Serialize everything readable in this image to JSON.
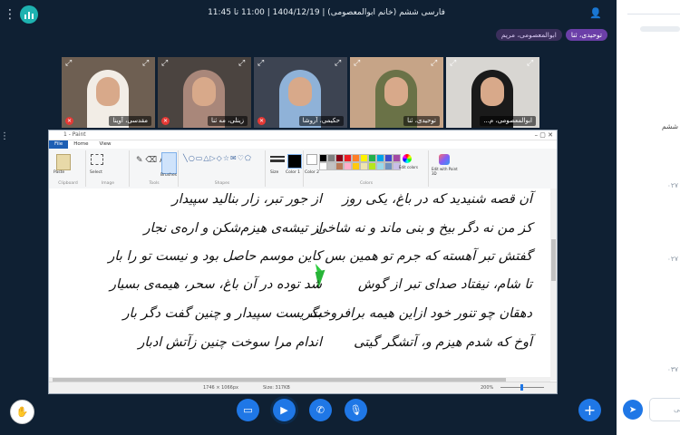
{
  "app": {
    "title": "فارسی ششم (خانم ابوالمعصومی) | 1404/12/19 | 11:00 تا 11:45",
    "speakers": [
      "توحیدی، ثنا",
      "ابوالمعصومی، مریم"
    ]
  },
  "participants": [
    {
      "name": "مقدسی، آوینا",
      "muted": true,
      "bg": "#6e5f52",
      "hijab": "#f2ede6",
      "selected": false
    },
    {
      "name": "زینلی، مه ثنا",
      "muted": true,
      "bg": "#4b4440",
      "hijab": "#a9877a",
      "selected": false
    },
    {
      "name": "حکیمی، آروشا",
      "muted": true,
      "bg": "#3d4452",
      "hijab": "#8fb2d8",
      "selected": false
    },
    {
      "name": "توحیدی، ثنا",
      "muted": false,
      "bg": "#c6a487",
      "hijab": "#6a7247",
      "selected": true
    },
    {
      "name": "ابوالمعصومی، م...",
      "muted": false,
      "bg": "#d8d6d2",
      "hijab": "#1a1a1a",
      "selected": false
    }
  ],
  "paint": {
    "window_title": "1 - Paint",
    "tabs": [
      "File",
      "Home",
      "View"
    ],
    "groups": [
      "Clipboard",
      "Image",
      "Tools",
      "Shapes",
      "Colors"
    ],
    "tools": {
      "paste": "Paste",
      "select": "Select",
      "brushes": "Brushes",
      "size": "Size",
      "color1": "Color 1",
      "color2": "Color 2",
      "edit_colors": "Edit colors",
      "paint3d": "Edit with Paint 3D"
    },
    "status_dims": "1746 × 1066px",
    "status_size": "Size: 317KB",
    "zoom": "200%",
    "palette": [
      "#000000",
      "#7f7f7f",
      "#880015",
      "#ed1c24",
      "#ff7f27",
      "#fff200",
      "#22b14c",
      "#00a2e8",
      "#3f48cc",
      "#a349a4",
      "#ffffff",
      "#c3c3c3",
      "#b97a57",
      "#ffaec9",
      "#ffc90e",
      "#efe4b0",
      "#b5e61d",
      "#99d9ea",
      "#7092be",
      "#c8bfe7"
    ],
    "poem_right": [
      "آن قصه شنیدید که در باغ، یکی روز",
      "کز من نه دگر بیخ و بنی ماند و نه شاخی",
      "گفتش تبر آهسته که جرم تو همین بس",
      "تا شام، نیفتاد صدای تبر از گوش",
      "دهقان چو تنور خود ازاین هیمه برافروخت",
      "آوخ که شدم هیزم و، آتشگر گیتی"
    ],
    "poem_left": [
      "از جور تبر، زار بنالید سپیدار",
      "از تیشه‌ی هیزم‌شکن و اره‌ی نجار",
      "کاین موسم حاصل بود و نیست تو را بار",
      "شد توده در آن باغ، سحر، هیمه‌ی بسیار",
      "بگریست سپیدار و چنین گفت دگر بار",
      "اندام مرا سوخت چنین زآتش ادبار"
    ]
  },
  "sidebar": {
    "heading_fragment": "ششم",
    "times": [
      "۰۲۷",
      "۰۲۷",
      "۰۳۷"
    ],
    "message_placeholder": "نکاتی"
  },
  "icons": [
    "menu-dots-icon",
    "app-logo-icon",
    "user-icon",
    "hand-icon",
    "screen-share-icon",
    "camera-icon",
    "phone-icon",
    "mic-icon",
    "plus-icon",
    "send-icon"
  ]
}
